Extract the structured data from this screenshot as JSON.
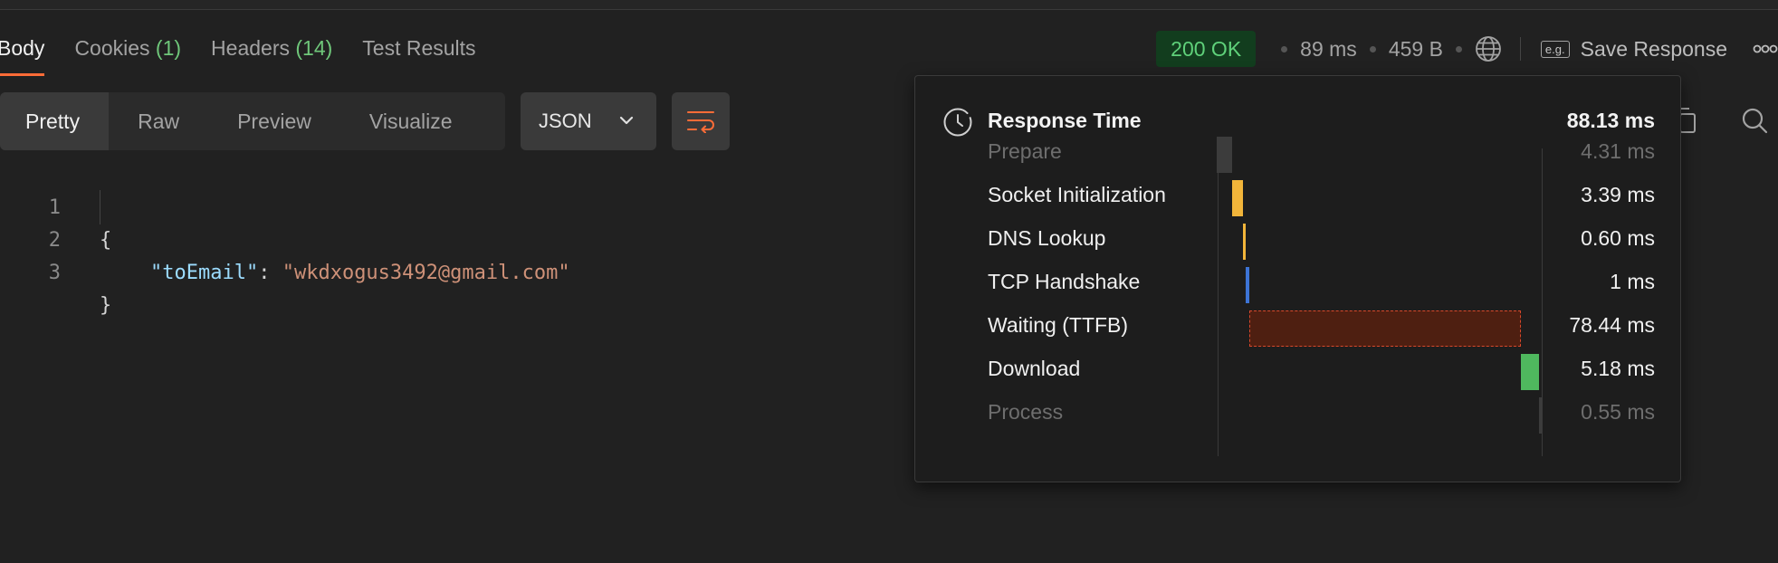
{
  "tabs": [
    {
      "label": "Body",
      "count": ""
    },
    {
      "label": "Cookies ",
      "count": "(1)"
    },
    {
      "label": "Headers ",
      "count": "(14)"
    },
    {
      "label": "Test Results",
      "count": ""
    }
  ],
  "status": {
    "code": "200 OK",
    "time": "89 ms",
    "size": "459 B",
    "save_icon_text": "e.g.",
    "save_label": "Save Response"
  },
  "view_modes": [
    "Pretty",
    "Raw",
    "Preview",
    "Visualize"
  ],
  "format_select": "JSON",
  "code_lines": [
    {
      "n": "1",
      "text": "{"
    },
    {
      "n": "2",
      "key": "\"toEmail\"",
      "sep": ": ",
      "value": "\"wkdxogus3492@gmail.com\""
    },
    {
      "n": "3",
      "text": "}"
    }
  ],
  "response_time": {
    "title": "Response Time",
    "total": "88.13 ms",
    "phases": [
      {
        "label": "Prepare",
        "value": "4.31 ms",
        "ms": 4.31,
        "color": "#3c3c3c",
        "dim": true
      },
      {
        "label": "Socket Initialization",
        "value": "3.39 ms",
        "ms": 3.39,
        "color": "#f2b53a",
        "dim": false
      },
      {
        "label": "DNS Lookup",
        "value": "0.60 ms",
        "ms": 0.6,
        "color": "#f2b53a",
        "dim": false
      },
      {
        "label": "TCP Handshake",
        "value": "1 ms",
        "ms": 1,
        "color": "#3d74d6",
        "dim": false
      },
      {
        "label": "Waiting (TTFB)",
        "value": "78.44 ms",
        "ms": 78.44,
        "color": "#4e1f11",
        "dim": false
      },
      {
        "label": "Download",
        "value": "5.18 ms",
        "ms": 5.18,
        "color": "#4fb85e",
        "dim": false
      },
      {
        "label": "Process",
        "value": "0.55 ms",
        "ms": 0.55,
        "color": "#3c3c3c",
        "dim": true
      }
    ]
  }
}
